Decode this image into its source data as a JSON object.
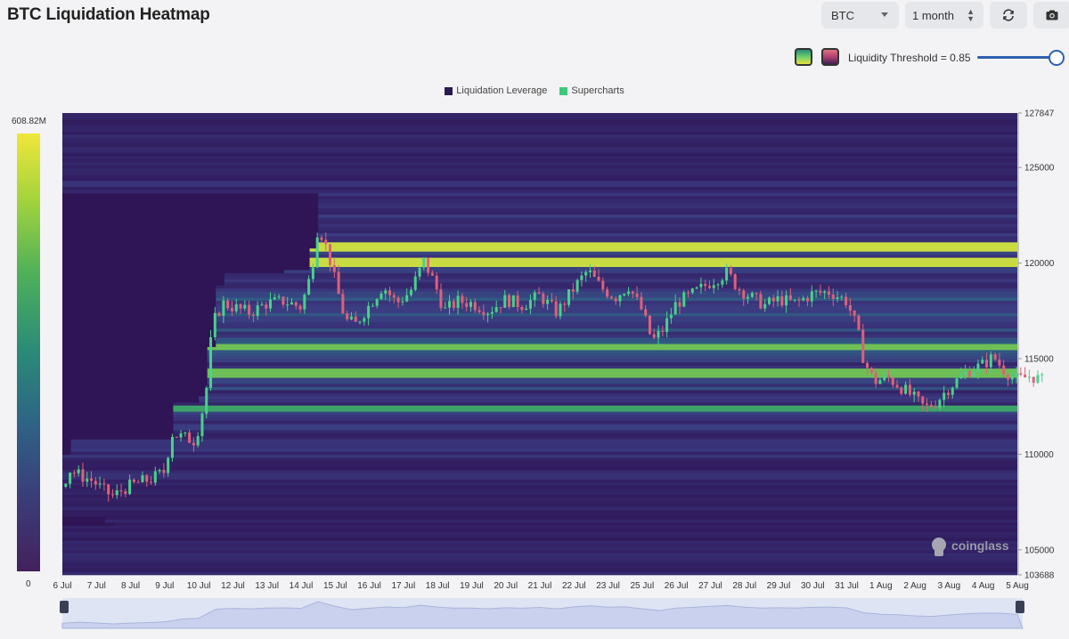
{
  "header": {
    "title": "BTC Liquidation Heatmap",
    "symbol_select": "BTC",
    "range_select": "1 month",
    "refresh_icon": "refresh-icon",
    "camera_icon": "camera-icon"
  },
  "threshold": {
    "label": "Liquidity Threshold = 0.85",
    "value": 0.85,
    "swatch_icons": [
      "viridis-palette-swatch",
      "red-palette-swatch"
    ]
  },
  "watermark": "coinglass",
  "chart_data": {
    "type": "heatmap",
    "title": "BTC Liquidation Heatmap",
    "legend": [
      {
        "name": "Liquidation Leverage",
        "color": "#2a1a4f"
      },
      {
        "name": "Supercharts",
        "color": "#3ec97a"
      }
    ],
    "legend_position": "top-center",
    "colorbar": {
      "max_label": "608.82M",
      "min_label": "0",
      "colors": [
        "#f0e63a",
        "#4fb05a",
        "#2a8a78",
        "#2e6484",
        "#43215c"
      ]
    },
    "ylim": [
      103688,
      127847
    ],
    "y_ticks": [
      "127847",
      "125000",
      "120000",
      "115000",
      "110000",
      "105000",
      "103688"
    ],
    "y_tick_values": [
      127847,
      125000,
      120000,
      115000,
      110000,
      105000,
      103688
    ],
    "x_ticks": [
      "6 Jul",
      "7 Jul",
      "8 Jul",
      "9 Jul",
      "10 Jul",
      "12 Jul",
      "13 Jul",
      "14 Jul",
      "15 Jul",
      "16 Jul",
      "17 Jul",
      "18 Jul",
      "19 Jul",
      "20 Jul",
      "21 Jul",
      "22 Jul",
      "23 Jul",
      "25 Jul",
      "26 Jul",
      "27 Jul",
      "28 Jul",
      "29 Jul",
      "30 Jul",
      "31 Jul",
      "1 Aug",
      "2 Aug",
      "3 Aug",
      "4 Aug",
      "5 Aug"
    ],
    "price_series": {
      "name": "Supercharts",
      "points": [
        [
          0,
          108300
        ],
        [
          0.2,
          109200
        ],
        [
          0.5,
          108900
        ],
        [
          0.9,
          108600
        ],
        [
          1.2,
          108100
        ],
        [
          1.5,
          107800
        ],
        [
          1.8,
          108200
        ],
        [
          2.2,
          108500
        ],
        [
          2.6,
          108700
        ],
        [
          3.0,
          109100
        ],
        [
          3.2,
          111100
        ],
        [
          3.5,
          110900
        ],
        [
          3.9,
          110700
        ],
        [
          4.2,
          113000
        ],
        [
          4.4,
          116800
        ],
        [
          4.7,
          117900
        ],
        [
          5.0,
          117700
        ],
        [
          5.5,
          117400
        ],
        [
          6.0,
          117900
        ],
        [
          6.5,
          118000
        ],
        [
          7.0,
          117700
        ],
        [
          7.3,
          119500
        ],
        [
          7.5,
          122000
        ],
        [
          7.8,
          120500
        ],
        [
          8.0,
          119000
        ],
        [
          8.3,
          117000
        ],
        [
          8.6,
          116800
        ],
        [
          9.0,
          117800
        ],
        [
          9.4,
          118800
        ],
        [
          9.8,
          117900
        ],
        [
          10.2,
          118500
        ],
        [
          10.6,
          120100
        ],
        [
          10.9,
          119000
        ],
        [
          11.2,
          117500
        ],
        [
          11.6,
          118000
        ],
        [
          12.0,
          117900
        ],
        [
          12.5,
          117500
        ],
        [
          13.0,
          118100
        ],
        [
          13.5,
          117800
        ],
        [
          14.0,
          118300
        ],
        [
          14.5,
          117400
        ],
        [
          15.0,
          118700
        ],
        [
          15.4,
          119600
        ],
        [
          15.8,
          118700
        ],
        [
          16.2,
          118200
        ],
        [
          16.6,
          118800
        ],
        [
          17.0,
          117500
        ],
        [
          17.3,
          115900
        ],
        [
          17.6,
          116500
        ],
        [
          18.0,
          117900
        ],
        [
          18.5,
          118400
        ],
        [
          19.0,
          119000
        ],
        [
          19.5,
          119500
        ],
        [
          19.8,
          118700
        ],
        [
          20.2,
          118200
        ],
        [
          20.6,
          117800
        ],
        [
          21.0,
          118100
        ],
        [
          21.5,
          117900
        ],
        [
          22.0,
          118400
        ],
        [
          22.5,
          118500
        ],
        [
          23.0,
          118000
        ],
        [
          23.3,
          116600
        ],
        [
          23.5,
          114900
        ],
        [
          23.8,
          113800
        ],
        [
          24.2,
          114000
        ],
        [
          24.6,
          113500
        ],
        [
          25.0,
          112900
        ],
        [
          25.3,
          112400
        ],
        [
          25.6,
          112700
        ],
        [
          26.0,
          113500
        ],
        [
          26.5,
          114300
        ],
        [
          27.0,
          114700
        ],
        [
          27.3,
          115100
        ],
        [
          27.6,
          114400
        ],
        [
          28.0,
          113900
        ],
        [
          28.4,
          114100
        ],
        [
          28.8,
          113800
        ]
      ]
    }
  }
}
